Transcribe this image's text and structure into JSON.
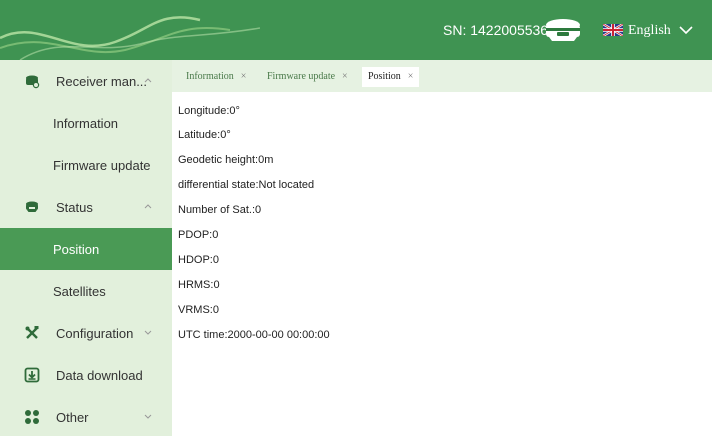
{
  "header": {
    "sn_text": "SN: 1422005536",
    "device_icon": "gnss-receiver-icon",
    "flag_icon": "uk-flag-icon",
    "language": "English",
    "colors": {
      "bar": "#3f9352",
      "sidebar": "#e2f0dc",
      "active": "#4a9a55"
    }
  },
  "sidebar": {
    "items": [
      {
        "label": "Receiver man...",
        "icon": "receiver-icon",
        "expanded": true
      },
      {
        "label": "Information"
      },
      {
        "label": "Firmware update"
      },
      {
        "label": "Status",
        "icon": "status-device-icon",
        "expanded": true
      },
      {
        "label": "Position",
        "active": true
      },
      {
        "label": "Satellites"
      },
      {
        "label": "Configuration",
        "icon": "tools-icon",
        "expanded": false
      },
      {
        "label": "Data download",
        "icon": "download-icon"
      },
      {
        "label": "Other",
        "icon": "grid-icon",
        "expanded": false
      }
    ]
  },
  "tabs": [
    {
      "label": "Information",
      "close": "×"
    },
    {
      "label": "Firmware update",
      "close": "×"
    },
    {
      "label": "Position",
      "close": "×",
      "selected": true
    }
  ],
  "position": {
    "longitude": "Longitude:0°",
    "latitude": "Latitude:0°",
    "geodetic_height": "Geodetic height:0m",
    "differential_state": "differential state:Not located",
    "num_sat": "Number of Sat.:0",
    "pdop": "PDOP:0",
    "hdop": "HDOP:0",
    "hrms": "HRMS:0",
    "vrms": "VRMS:0",
    "utc_time": "UTC time:2000-00-00 00:00:00"
  }
}
